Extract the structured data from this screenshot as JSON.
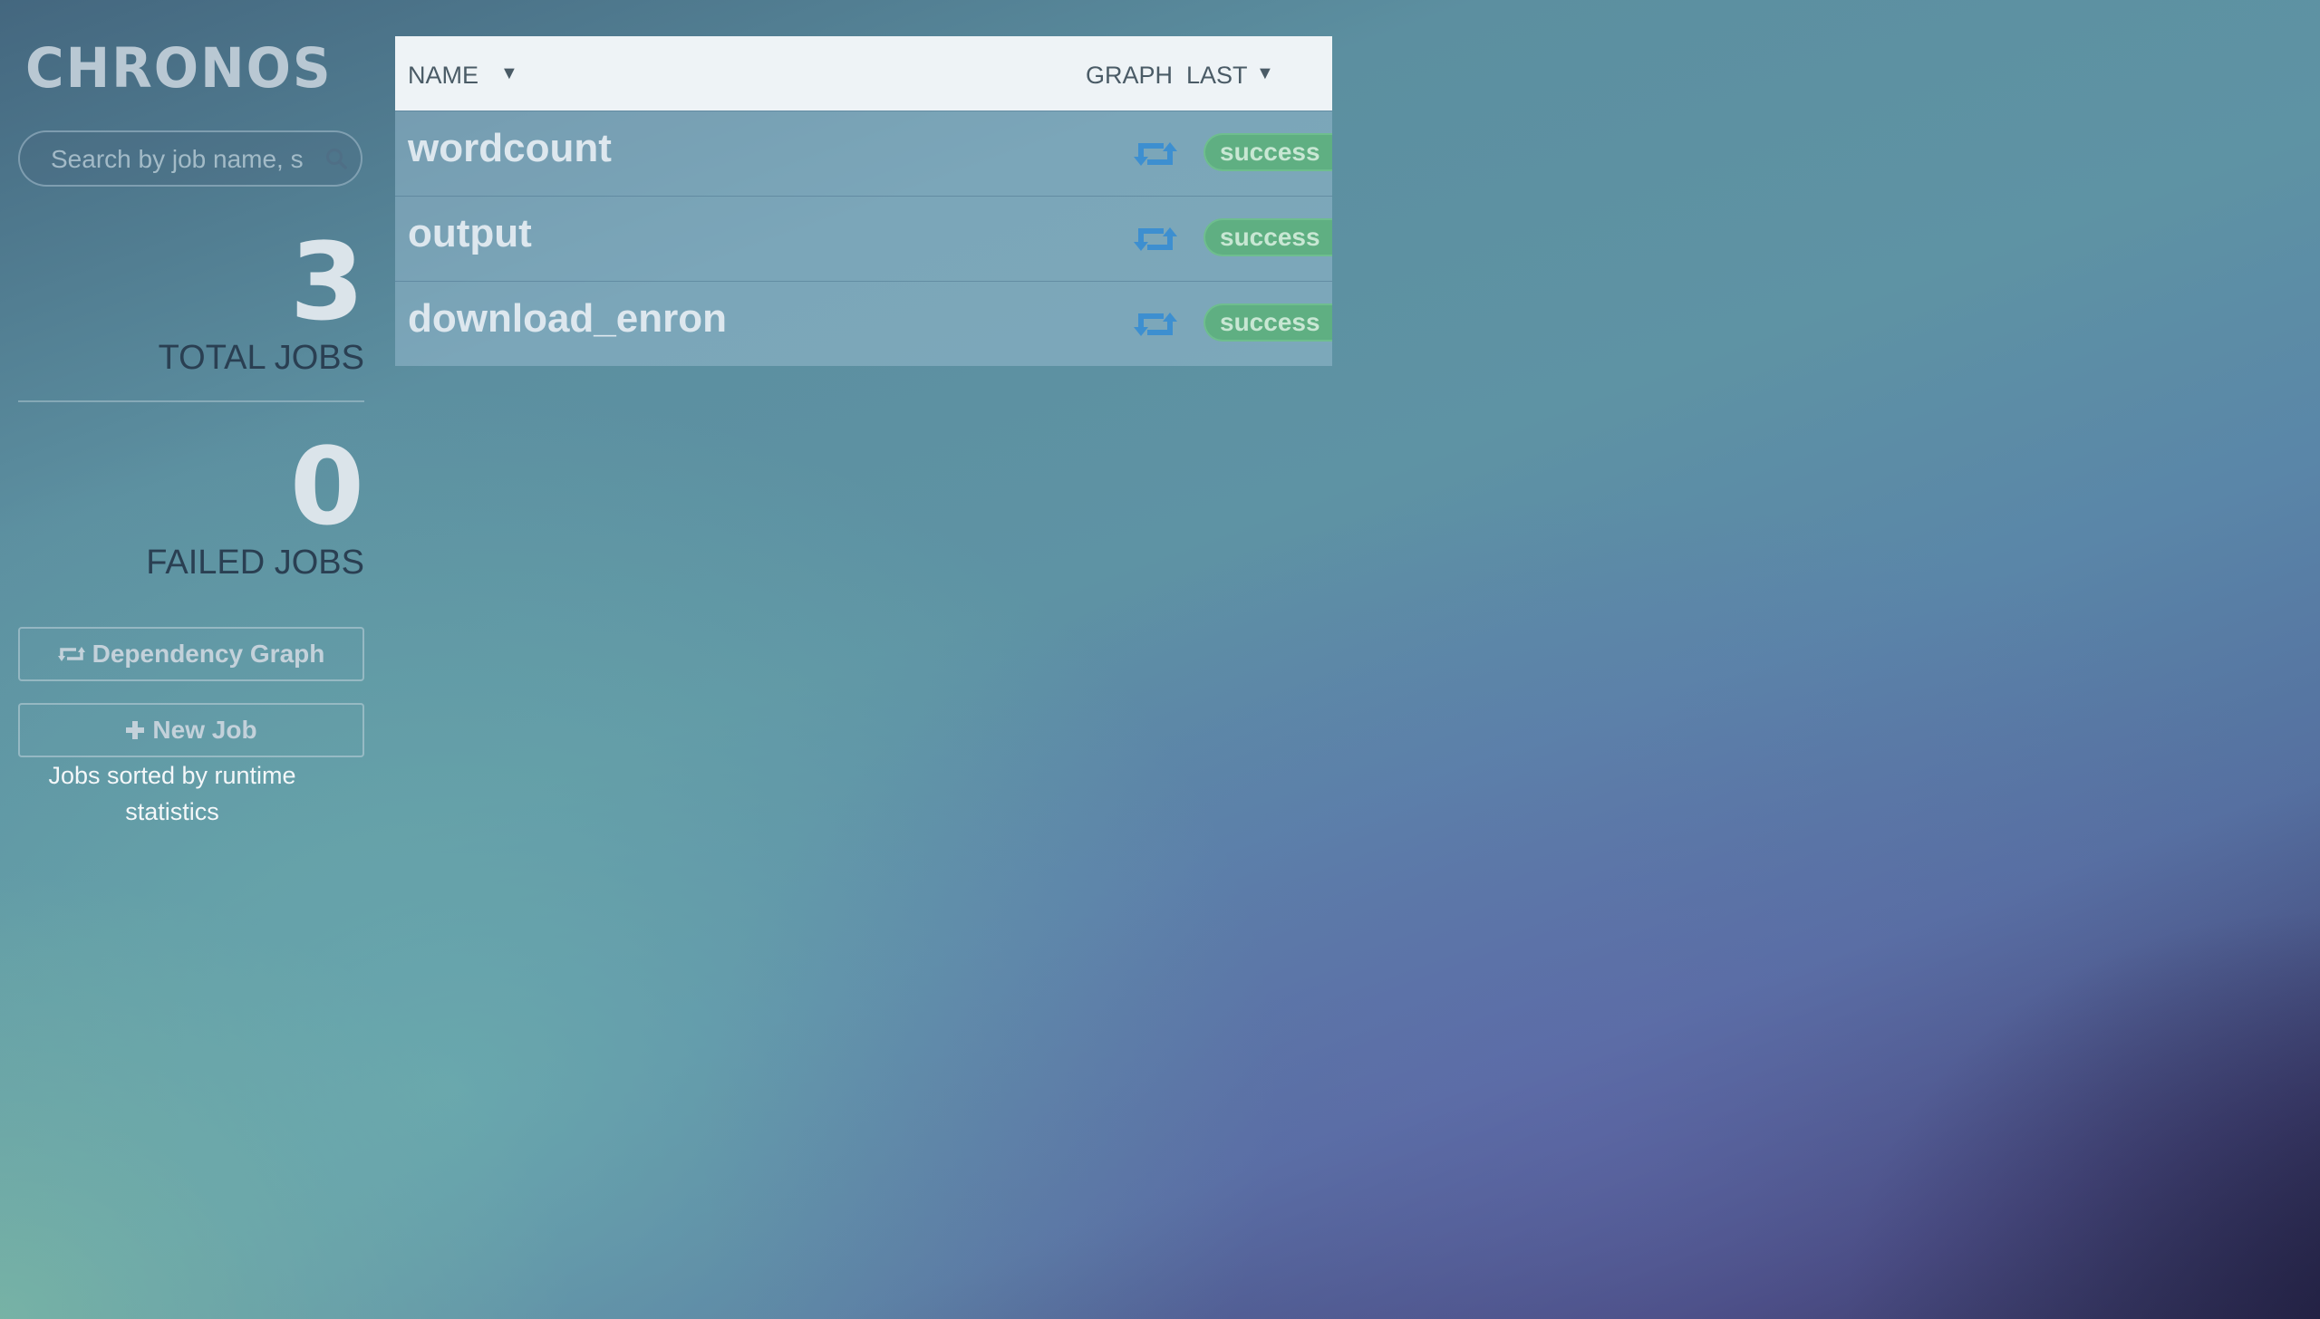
{
  "app": {
    "logo": "CHRONOS"
  },
  "search": {
    "placeholder": "Search by job name, s",
    "value": ""
  },
  "stats": {
    "total_jobs": {
      "value": "3",
      "label": "TOTAL JOBS"
    },
    "failed_jobs": {
      "value": "0",
      "label": "FAILED JOBS"
    }
  },
  "buttons": {
    "dependency_graph": {
      "label": "Dependency Graph",
      "icon": "retweet-icon"
    },
    "new_job": {
      "label": "New Job",
      "icon": "plus-icon"
    }
  },
  "sidebar_note": "Jobs sorted by runtime statistics",
  "table": {
    "columns": {
      "name": "NAME",
      "graph": "GRAPH",
      "last": "LAST"
    },
    "sort_indicator": "▼",
    "rows": [
      {
        "name": "wordcount",
        "status": "success"
      },
      {
        "name": "output",
        "status": "success"
      },
      {
        "name": "download_enron",
        "status": "success"
      }
    ]
  },
  "colors": {
    "success": "#5faf82",
    "graph_icon": "#3d8fd0",
    "header_bg": "#eef3f6"
  }
}
